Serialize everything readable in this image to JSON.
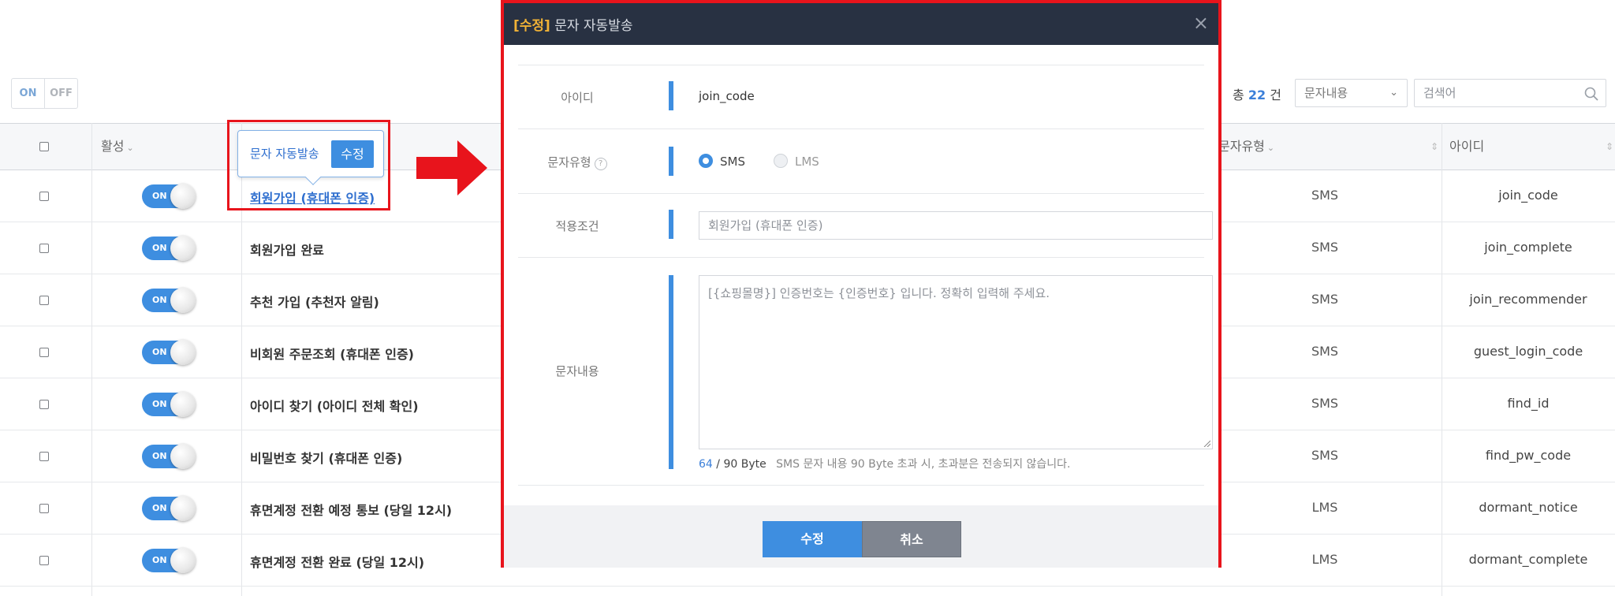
{
  "toolbar": {
    "on_label": "ON",
    "off_label": "OFF",
    "total_prefix": "총",
    "total_count": "22",
    "total_suffix": "건",
    "search_type": "문자내용",
    "search_placeholder": "검색어"
  },
  "table": {
    "headers": {
      "active": "활성",
      "msg_type": "문자유형",
      "id": "아이디"
    },
    "toggle_label": "ON",
    "rows": [
      {
        "name": "회원가입 (휴대폰 인증)",
        "type": "SMS",
        "id": "join_code"
      },
      {
        "name": "회원가입 완료",
        "type": "SMS",
        "id": "join_complete"
      },
      {
        "name": "추천 가입 (추천자 알림)",
        "type": "SMS",
        "id": "join_recommender"
      },
      {
        "name": "비회원 주문조회 (휴대폰 인증)",
        "type": "SMS",
        "id": "guest_login_code"
      },
      {
        "name": "아이디 찾기 (아이디 전체 확인)",
        "type": "SMS",
        "id": "find_id"
      },
      {
        "name": "비밀번호 찾기 (휴대폰 인증)",
        "type": "SMS",
        "id": "find_pw_code"
      },
      {
        "name": "휴면계정 전환 예정 통보 (당일 12시)",
        "type": "LMS",
        "id": "dormant_notice"
      },
      {
        "name": "휴면계정 전환 완료 (당일 12시)",
        "type": "LMS",
        "id": "dormant_complete"
      }
    ]
  },
  "tooltip": {
    "label": "문자 자동발송",
    "button": "수정"
  },
  "modal": {
    "title_tag": "[수정]",
    "title": "문자 자동발송",
    "close": "×",
    "fields": {
      "id_label": "아이디",
      "id_value": "join_code",
      "type_label": "문자유형",
      "help": "?",
      "type_options": [
        "SMS",
        "LMS"
      ],
      "type_selected": "SMS",
      "condition_label": "적용조건",
      "condition_placeholder": "회원가입 (휴대폰 인증)",
      "content_label": "문자내용",
      "content_placeholder": "[{쇼핑몰명}] 인증번호는 {인증번호} 입니다. 정확히 입력해 주세요.",
      "byte_current": "64",
      "byte_max": "/ 90 Byte",
      "byte_note": "SMS 문자 내용 90 Byte 초과 시, 초과분은 전송되지 않습니다."
    },
    "buttons": {
      "save": "수정",
      "cancel": "취소"
    }
  },
  "colors": {
    "accent_blue": "#3e8ee0",
    "highlight_red": "#e8141c",
    "modal_header": "#283142",
    "title_tag": "#f0b236"
  }
}
